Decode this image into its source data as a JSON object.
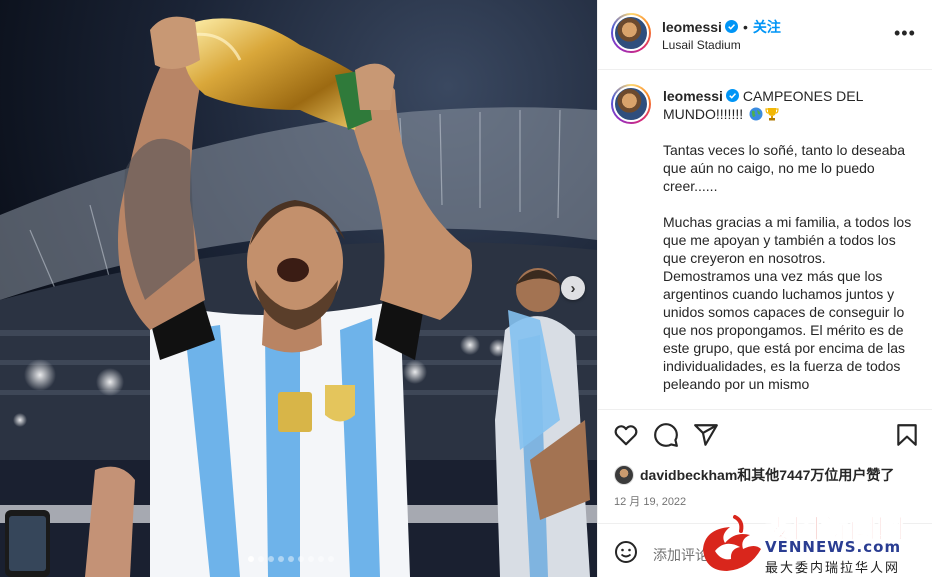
{
  "post": {
    "username": "leomessi",
    "follow_label": "关注",
    "location": "Lusail Stadium",
    "more_label": "•••",
    "next_label": "›"
  },
  "caption": {
    "username": "leomessi",
    "headline": "CAMPEONES DEL MUNDO!!!!!!!",
    "paragraphs": [
      "Tantas veces lo soñé, tanto lo deseaba que aún no caigo, no me lo puedo creer......",
      "Muchas gracias a mi familia, a todos los que me apoyan y también a todos los que creyeron en nosotros. Demostramos una vez más que los argentinos cuando luchamos juntos y unidos somos capaces de conseguir lo que nos propongamos. El mérito es de este grupo, que está por encima de las individualidades, es la fuerza de todos peleando por un mismo"
    ],
    "emojis": [
      "globe-emoji",
      "trophy-emoji"
    ]
  },
  "engagement": {
    "likes_text": "davidbeckham和其他7447万位用户赞了",
    "date": "12 月 19, 2022"
  },
  "comment": {
    "placeholder": "添加评论..."
  },
  "icons": [
    "heart-icon",
    "comment-icon",
    "share-icon",
    "bookmark-icon",
    "emoji-icon",
    "verified-icon",
    "more-icon",
    "chevron-right-icon"
  ],
  "watermark": {
    "title": "委国新闻网",
    "domain": "VENNEWS.com",
    "slogan": "最大委内瑞拉华人网"
  },
  "colors": {
    "accent": "#0095f6",
    "text": "#262626",
    "muted": "#737373",
    "watermark_red": "#d9261c",
    "watermark_blue": "#2a3d92"
  },
  "carousel": {
    "slide_count": 9,
    "current": 1
  }
}
